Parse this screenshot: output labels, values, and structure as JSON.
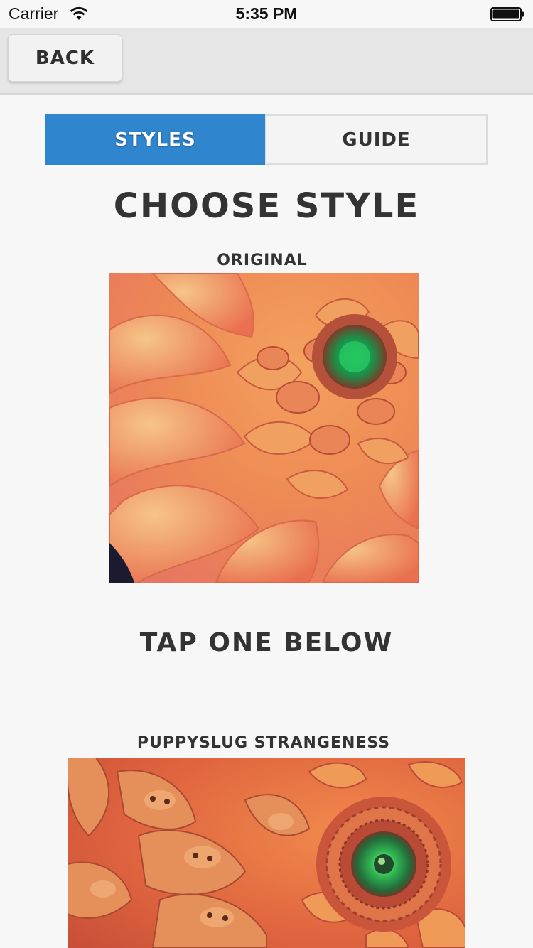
{
  "status_bar": {
    "carrier": "Carrier",
    "time": "5:35 PM"
  },
  "nav": {
    "back_label": "BACK"
  },
  "tabs": [
    {
      "label": "STYLES",
      "active": true
    },
    {
      "label": "GUIDE",
      "active": false
    }
  ],
  "main": {
    "title": "CHOOSE STYLE",
    "original_label": "ORIGINAL",
    "tap_prompt": "TAP ONE BELOW",
    "styles": [
      {
        "label": "PUPPYSLUG STRANGENESS"
      }
    ]
  },
  "colors": {
    "accent": "#2f86cf",
    "background": "#f7f7f7",
    "nav_background": "#e6e6e6",
    "text": "#333333"
  },
  "icons": [
    "wifi-icon",
    "battery-icon"
  ]
}
